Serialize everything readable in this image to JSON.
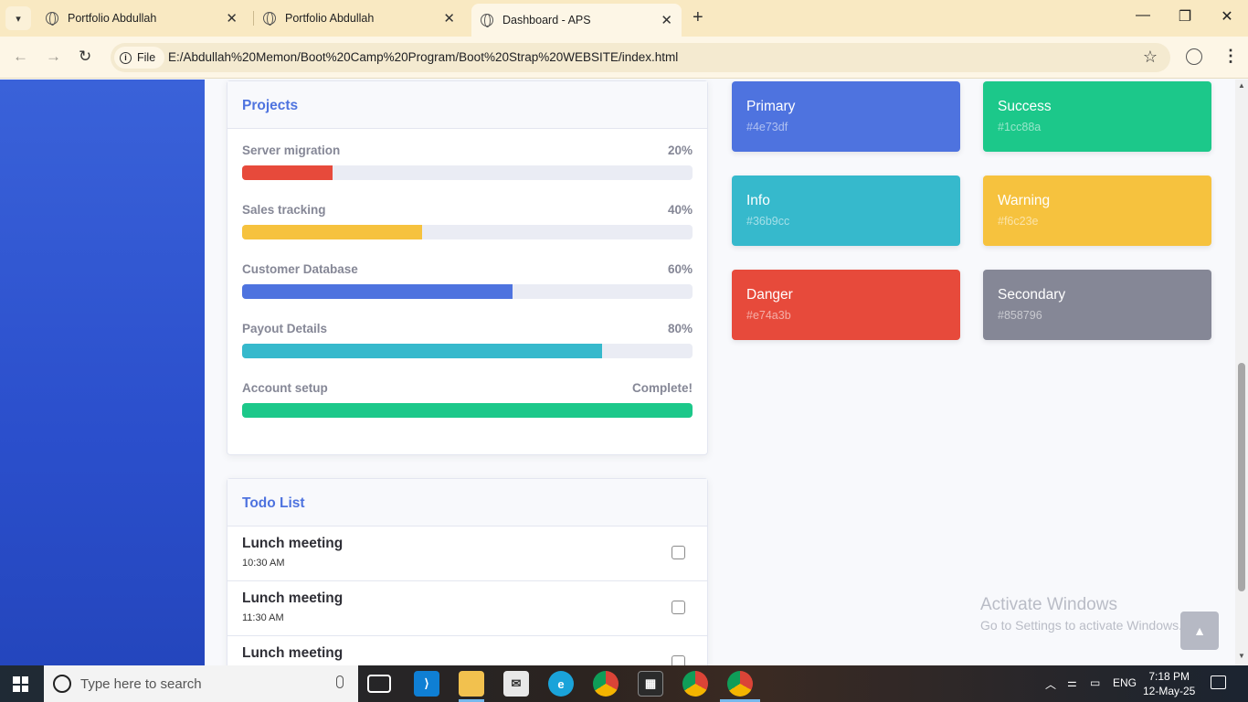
{
  "browser": {
    "tabs": [
      {
        "title": "Portfolio Abdullah",
        "active": false
      },
      {
        "title": "Portfolio Abdullah",
        "active": false
      },
      {
        "title": "Dashboard - APS",
        "active": true
      }
    ],
    "close_glyph": "✕",
    "new_tab_glyph": "+",
    "security_chip": "File",
    "url": "E:/Abdullah%20Memon/Boot%20Camp%20Program/Boot%20Strap%20WEBSITE/index.html"
  },
  "projects": {
    "title": "Projects",
    "items": [
      {
        "name": "Server migration",
        "label": "20%",
        "percent": 20,
        "color": "#e74a3b"
      },
      {
        "name": "Sales tracking",
        "label": "40%",
        "percent": 40,
        "color": "#f6c23e"
      },
      {
        "name": "Customer Database",
        "label": "60%",
        "percent": 60,
        "color": "#4e73df"
      },
      {
        "name": "Payout Details",
        "label": "80%",
        "percent": 80,
        "color": "#36b9cc"
      },
      {
        "name": "Account setup",
        "label": "Complete!",
        "percent": 100,
        "color": "#1cc88a"
      }
    ]
  },
  "todo": {
    "title": "Todo List",
    "items": [
      {
        "title": "Lunch meeting",
        "time": "10:30 AM"
      },
      {
        "title": "Lunch meeting",
        "time": "11:30 AM"
      },
      {
        "title": "Lunch meeting",
        "time": ""
      }
    ]
  },
  "colors": [
    {
      "name": "Primary",
      "code": "#4e73df",
      "bg": "#4e73df"
    },
    {
      "name": "Success",
      "code": "#1cc88a",
      "bg": "#1cc88a"
    },
    {
      "name": "Info",
      "code": "#36b9cc",
      "bg": "#36b9cc"
    },
    {
      "name": "Warning",
      "code": "#f6c23e",
      "bg": "#f6c23e"
    },
    {
      "name": "Danger",
      "code": "#e74a3b",
      "bg": "#e74a3b"
    },
    {
      "name": "Secondary",
      "code": "#858796",
      "bg": "#858796"
    }
  ],
  "watermark": {
    "line1": "Activate Windows",
    "line2": "Go to Settings to activate Windows."
  },
  "taskbar": {
    "search_placeholder": "Type here to search",
    "language": "ENG",
    "time": "7:18 PM",
    "date": "12-May-25"
  }
}
